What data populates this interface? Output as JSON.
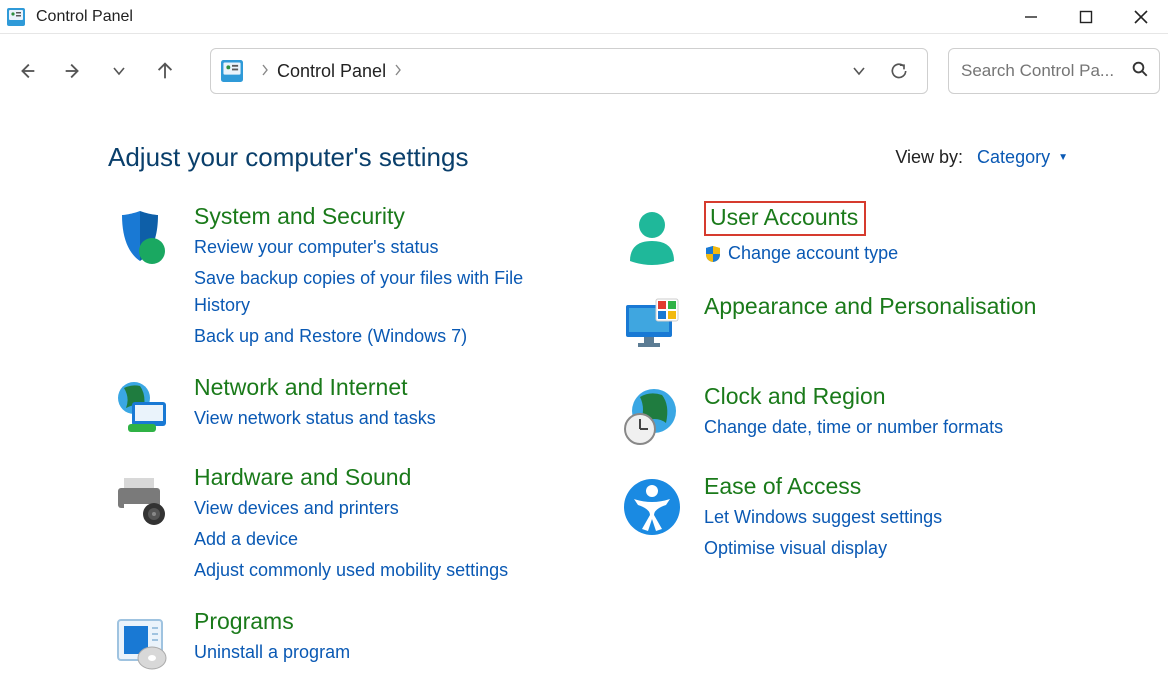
{
  "window": {
    "title": "Control Panel"
  },
  "breadcrumb": {
    "item": "Control Panel"
  },
  "search": {
    "placeholder": "Search Control Pa..."
  },
  "header": {
    "title": "Adjust your computer's settings"
  },
  "viewby": {
    "label": "View by:",
    "value": "Category"
  },
  "categories": {
    "system": {
      "title": "System and Security",
      "links": [
        "Review your computer's status",
        "Save backup copies of your files with File History",
        "Back up and Restore (Windows 7)"
      ]
    },
    "network": {
      "title": "Network and Internet",
      "links": [
        "View network status and tasks"
      ]
    },
    "hardware": {
      "title": "Hardware and Sound",
      "links": [
        "View devices and printers",
        "Add a device",
        "Adjust commonly used mobility settings"
      ]
    },
    "programs": {
      "title": "Programs",
      "links": [
        "Uninstall a program"
      ]
    },
    "user": {
      "title": "User Accounts",
      "links": [
        "Change account type"
      ]
    },
    "appearance": {
      "title": "Appearance and Personalisation",
      "links": []
    },
    "clock": {
      "title": "Clock and Region",
      "links": [
        "Change date, time or number formats"
      ]
    },
    "ease": {
      "title": "Ease of Access",
      "links": [
        "Let Windows suggest settings",
        "Optimise visual display"
      ]
    }
  }
}
